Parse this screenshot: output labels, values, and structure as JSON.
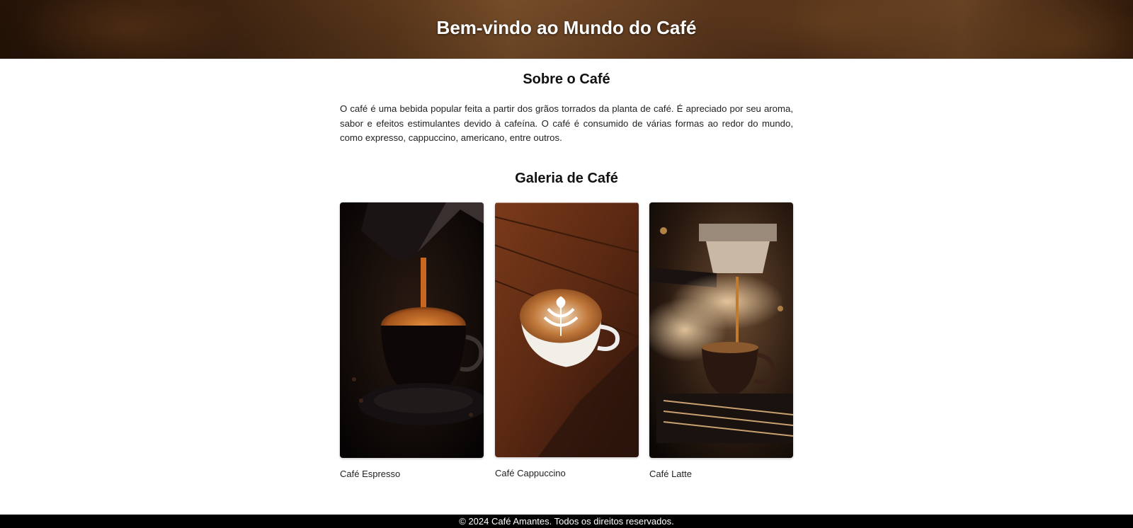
{
  "header": {
    "title": "Bem-vindo ao Mundo do Café"
  },
  "about": {
    "title": "Sobre o Café",
    "text": "O café é uma bebida popular feita a partir dos grãos torrados da planta de café. É apreciado por seu aroma, sabor e efeitos estimulantes devido à cafeína. O café é consumido de várias formas ao redor do mundo, como expresso, cappuccino, americano, entre outros."
  },
  "gallery": {
    "title": "Galeria de Café",
    "items": [
      {
        "caption": "Café Espresso",
        "image": "espresso-pour-photo"
      },
      {
        "caption": "Café Cappuccino",
        "image": "latte-art-cup-photo"
      },
      {
        "caption": "Café Latte",
        "image": "espresso-machine-photo"
      }
    ]
  },
  "footer": {
    "text": "© 2024 Café Amantes. Todos os direitos reservados."
  },
  "colors": {
    "footer_bg": "#000000",
    "banner_brown": "#6b4220",
    "text": "#111111"
  }
}
